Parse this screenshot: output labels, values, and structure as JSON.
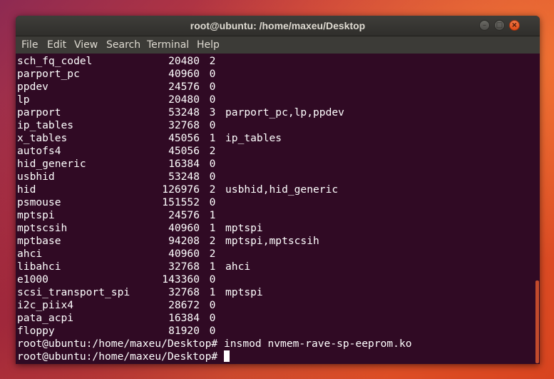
{
  "window": {
    "title": "root@ubuntu: /home/maxeu/Desktop"
  },
  "menu": {
    "items": [
      "File",
      "Edit",
      "View",
      "Search",
      "Terminal",
      "Help"
    ]
  },
  "modules": [
    {
      "name": "sch_fq_codel",
      "size": "20480",
      "used": "2",
      "by": ""
    },
    {
      "name": "parport_pc",
      "size": "40960",
      "used": "0",
      "by": ""
    },
    {
      "name": "ppdev",
      "size": "24576",
      "used": "0",
      "by": ""
    },
    {
      "name": "lp",
      "size": "20480",
      "used": "0",
      "by": ""
    },
    {
      "name": "parport",
      "size": "53248",
      "used": "3",
      "by": "parport_pc,lp,ppdev"
    },
    {
      "name": "ip_tables",
      "size": "32768",
      "used": "0",
      "by": ""
    },
    {
      "name": "x_tables",
      "size": "45056",
      "used": "1",
      "by": "ip_tables"
    },
    {
      "name": "autofs4",
      "size": "45056",
      "used": "2",
      "by": ""
    },
    {
      "name": "hid_generic",
      "size": "16384",
      "used": "0",
      "by": ""
    },
    {
      "name": "usbhid",
      "size": "53248",
      "used": "0",
      "by": ""
    },
    {
      "name": "hid",
      "size": "126976",
      "used": "2",
      "by": "usbhid,hid_generic"
    },
    {
      "name": "psmouse",
      "size": "151552",
      "used": "0",
      "by": ""
    },
    {
      "name": "mptspi",
      "size": "24576",
      "used": "1",
      "by": ""
    },
    {
      "name": "mptscsih",
      "size": "40960",
      "used": "1",
      "by": "mptspi"
    },
    {
      "name": "mptbase",
      "size": "94208",
      "used": "2",
      "by": "mptspi,mptscsih"
    },
    {
      "name": "ahci",
      "size": "40960",
      "used": "2",
      "by": ""
    },
    {
      "name": "libahci",
      "size": "32768",
      "used": "1",
      "by": "ahci"
    },
    {
      "name": "e1000",
      "size": "143360",
      "used": "0",
      "by": ""
    },
    {
      "name": "scsi_transport_spi",
      "size": "32768",
      "used": "1",
      "by": "mptspi"
    },
    {
      "name": "i2c_piix4",
      "size": "28672",
      "used": "0",
      "by": ""
    },
    {
      "name": "pata_acpi",
      "size": "16384",
      "used": "0",
      "by": ""
    },
    {
      "name": "floppy",
      "size": "81920",
      "used": "0",
      "by": ""
    }
  ],
  "prompt_lines": [
    {
      "prompt": "root@ubuntu:/home/maxeu/Desktop#",
      "command": " insmod nvmem-rave-sp-eeprom.ko"
    },
    {
      "prompt": "root@ubuntu:/home/maxeu/Desktop#",
      "command": " "
    }
  ],
  "colors": {
    "terminal_bg": "#300a24",
    "text": "#ffffff",
    "close_button": "#df4b16",
    "scrollbar_thumb": "#c24a2c"
  },
  "icons": [
    "minimize-icon",
    "maximize-icon",
    "close-icon"
  ]
}
